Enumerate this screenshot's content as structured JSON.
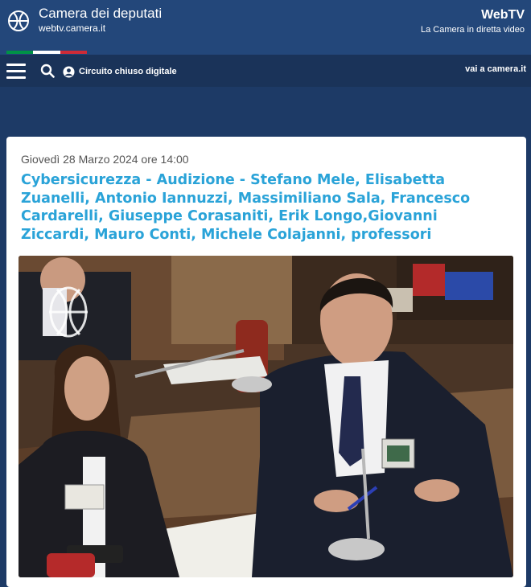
{
  "header": {
    "site_title": "Camera dei deputati",
    "site_url": "webtv.camera.it",
    "webtv_title": "WebTV",
    "webtv_subtitle": "La Camera in diretta video",
    "logo_icon": "camera-deputati-logo-icon",
    "flag_colors": [
      "#009246",
      "#ffffff",
      "#ce2b37"
    ]
  },
  "nav": {
    "menu_icon": "hamburger-menu-icon",
    "search_icon": "search-icon",
    "user_icon": "user-circle-icon",
    "closed_circuit_label": "Circuito chiuso digitale",
    "camera_link": "vai a camera.it"
  },
  "event": {
    "date": "Giovedì 28 Marzo 2024 ore 14:00",
    "title": "Cybersicurezza - Audizione - Stefano Mele, Elisabetta Zuanelli, Antonio Iannuzzi, Massimiliano Sala, Francesco Cardarelli, Giuseppe Corasaniti, Erik Longo,Giovanni Ziccardi, Mauro Conti, Michele Colajanni, professori",
    "title_color": "#2aa3d8"
  },
  "video": {
    "watermark_icon": "camera-deputati-watermark-icon"
  }
}
